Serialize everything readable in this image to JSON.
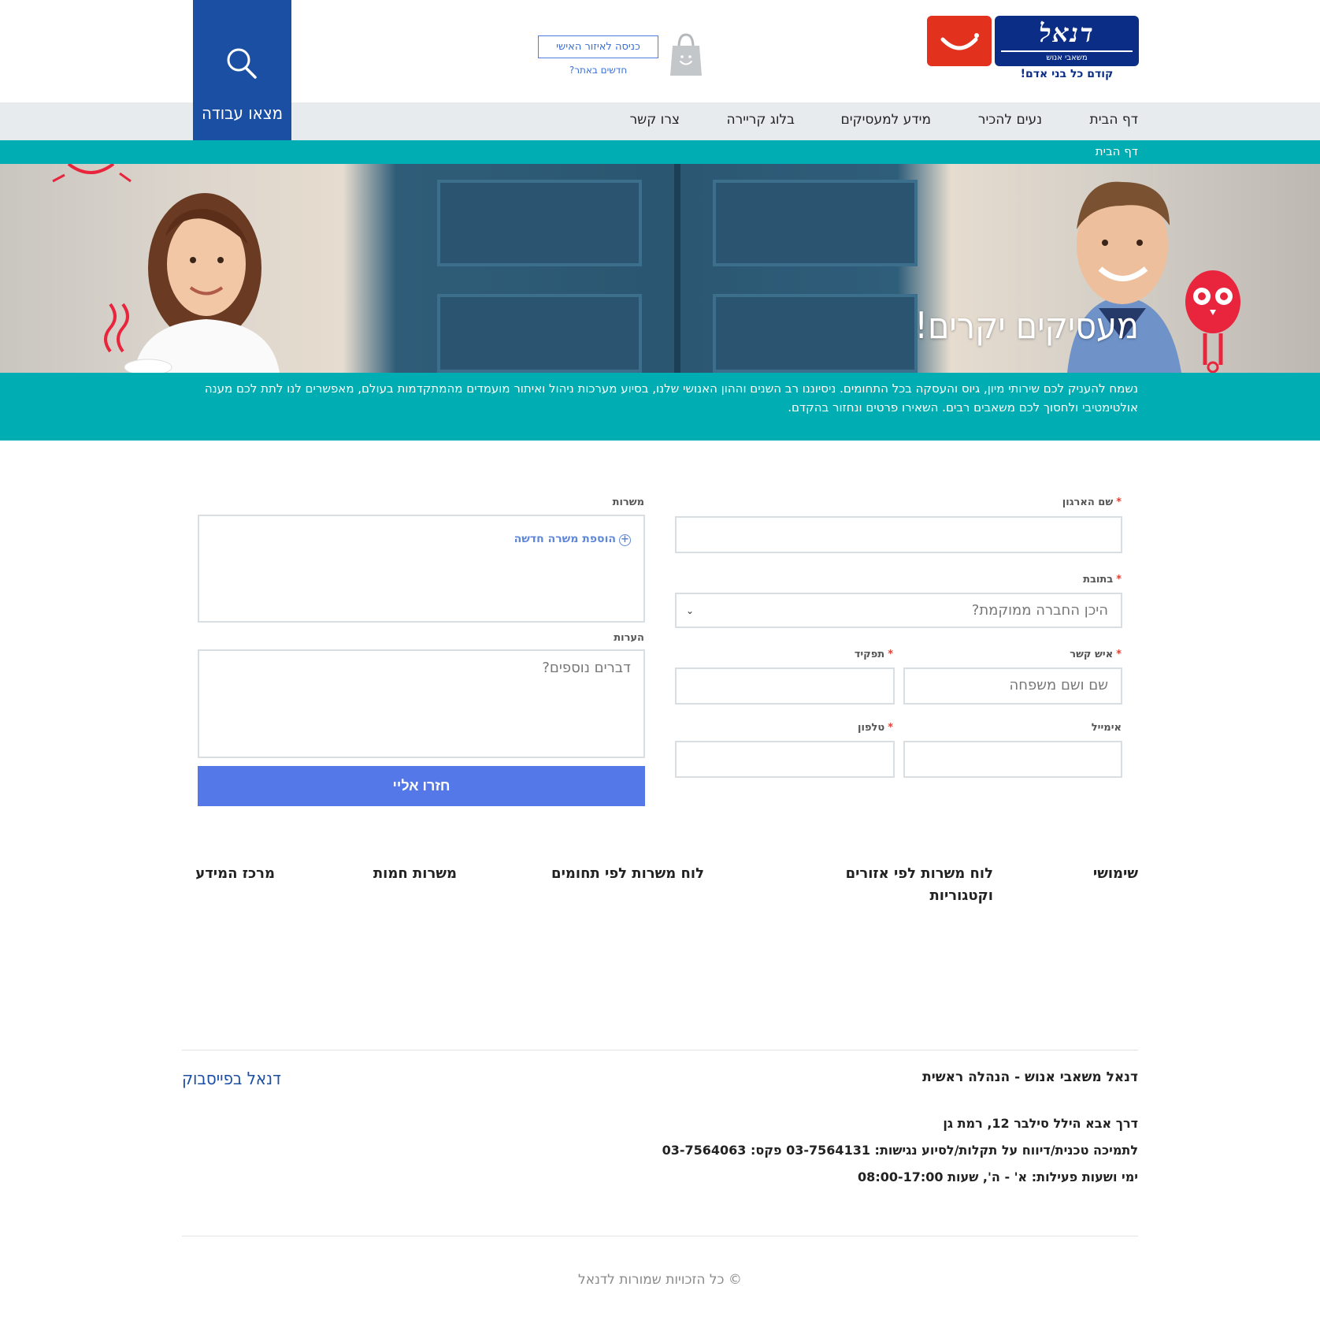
{
  "brand": {
    "name": "דנאל",
    "sub": "משאבי אנוש",
    "slogan": "קודם כל בני אדם!"
  },
  "header": {
    "personal_area": "כניסה לאיזור האישי",
    "new_here": "חדשים באתר?",
    "find_job": "מצאו עבודה"
  },
  "nav": {
    "items": [
      "דף הבית",
      "נעים להכיר",
      "מידע למעסיקים",
      "בלוג קריירה",
      "צרו קשר"
    ]
  },
  "breadcrumb": "דף הבית",
  "hero": {
    "title": "מעסיקים יקרים!"
  },
  "intro": "נשמח להעניק לכם שירותי מיון, גיוס והעסקה בכל התחומים. ניסיוננו רב השנים וההון האנושי שלנו, בסיוע מערכות ניהול ואיתור מועמדים מהמתקדמות בעולם, מאפשרים לנו לתת לכם מענה אולטימטיבי ולחסוך לכם משאבים רבים. השאירו פרטים ונחזור בהקדם.",
  "form": {
    "org_label": "שם הארגון",
    "address_label": "בתובת",
    "address_placeholder": "היכן החברה ממוקמת?",
    "contact_label": "איש קשר",
    "contact_placeholder": "שם ושם משפחה",
    "role_label": "תפקיד",
    "email_label": "אימייל",
    "phone_label": "טלפון",
    "positions_label": "משרות",
    "add_position": "הוספת משרה חדשה",
    "notes_label": "הערות",
    "notes_placeholder": "דברים נוספים?",
    "submit": "חזרו אליי"
  },
  "footer_links": [
    "שימושי",
    "לוח משרות לפי אזורים וקטגוריות",
    "לוח משרות לפי תחומים",
    "משרות חמות",
    "מרכז המידע"
  ],
  "footer": {
    "title": "דנאל משאבי אנוש - הנהלה ראשית",
    "facebook": "דנאל בפייסבוק",
    "address": "דרך אבא הילל סילבר 12, רמת גן",
    "support": "לתמיכה טכנית/דיווח על תקלות/לסיוע נגישות: 03-7564131 פקס: 03-7564063",
    "hours": "ימי ושעות פעילות: א' - ה', שעות 08:00-17:00",
    "copyright": "© כל הזכויות שמורות לדנאל"
  },
  "colors": {
    "brand_blue": "#0b2d86",
    "accent_blue": "#1b4fa4",
    "teal": "#00adb2",
    "submit": "#5478e8",
    "smile_red": "#e2321e"
  }
}
